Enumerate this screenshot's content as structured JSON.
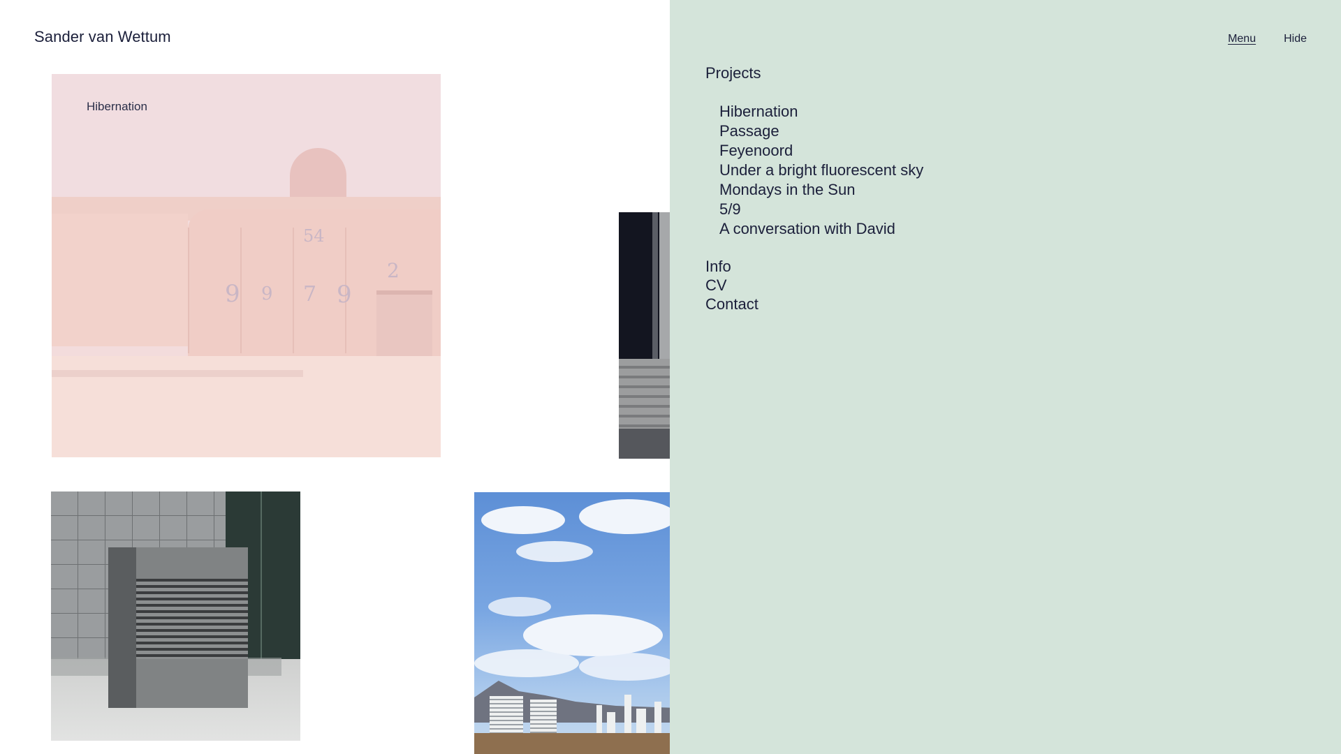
{
  "site": {
    "title": "Sander van Wettum"
  },
  "gallery": {
    "tiles": [
      {
        "label": "Hibernation",
        "image": "pink-concrete-building-photo"
      },
      {
        "image": "dark-corridor-photo"
      },
      {
        "image": "grey-cladded-building-photo"
      },
      {
        "image": "sky-and-city-photo"
      }
    ]
  },
  "menu": {
    "top_links": {
      "menu_label": "Menu",
      "hide_label": "Hide"
    },
    "projects_heading": "Projects",
    "projects": [
      "Hibernation",
      "Passage",
      "Feyenoord",
      "Under a bright fluorescent sky",
      "Mondays in the Sun",
      "5/9",
      "A conversation with David"
    ],
    "secondary": [
      "Info",
      "CV",
      "Contact"
    ]
  },
  "colors": {
    "menu_background": "#d4e4da",
    "text": "#1b1f3a",
    "hibernation_tint": "#f3dcdc"
  }
}
